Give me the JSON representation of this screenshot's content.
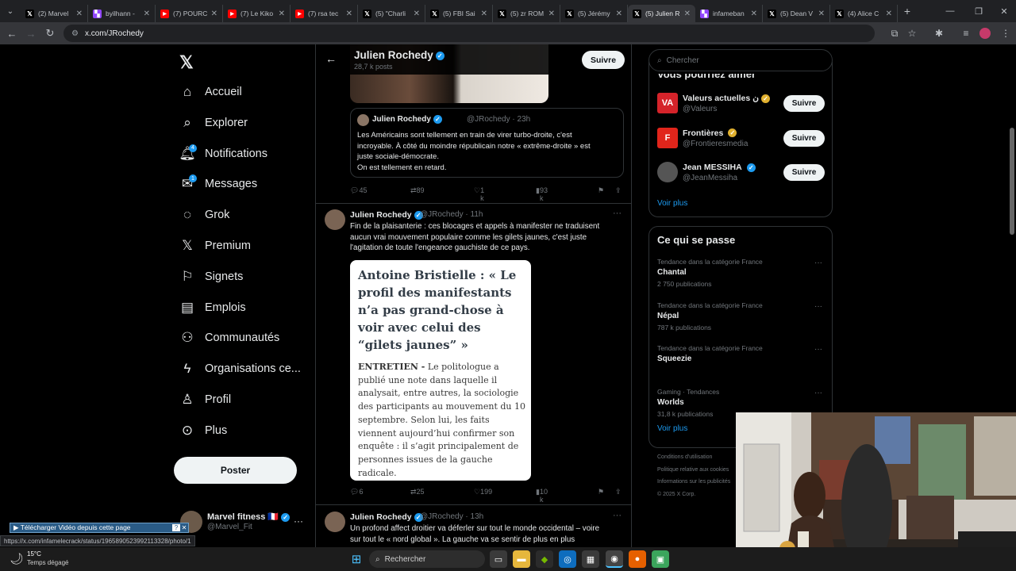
{
  "browser": {
    "tabs": [
      {
        "title": "(2) Marvel",
        "icon": "x-icon",
        "color": "#000000"
      },
      {
        "title": "byilhann -",
        "icon": "twitch-icon",
        "color": "#9146ff"
      },
      {
        "title": "(7) POURC",
        "icon": "youtube-icon",
        "color": "#ff0000"
      },
      {
        "title": "(7) Le Kiko",
        "icon": "youtube-icon",
        "color": "#ff0000"
      },
      {
        "title": "(7) rsa tec",
        "icon": "youtube-icon",
        "color": "#ff0000"
      },
      {
        "title": "(5) \"Charli",
        "icon": "x-icon",
        "color": "#000000"
      },
      {
        "title": "(5) FBI Sai",
        "icon": "x-icon",
        "color": "#000000"
      },
      {
        "title": "(5) zr ROM",
        "icon": "x-icon",
        "color": "#000000"
      },
      {
        "title": "(5) Jérémy",
        "icon": "x-icon",
        "color": "#000000"
      },
      {
        "title": "(5) Julien R",
        "icon": "x-icon",
        "color": "#000000",
        "active": true
      },
      {
        "title": "infameban",
        "icon": "twitch-icon",
        "color": "#9146ff"
      },
      {
        "title": "(5) Dean V",
        "icon": "x-icon",
        "color": "#000000"
      },
      {
        "title": "(4) Alice C",
        "icon": "x-icon",
        "color": "#000000"
      }
    ],
    "url": "x.com/JRochedy",
    "status_url": "https://x.com/infamelecrack/status/1965890523992113328/photo/1",
    "download_bar": "▶ Télécharger Vidéo depuis cette page"
  },
  "sidebar": {
    "logo": "X",
    "items": [
      {
        "label": "Accueil",
        "icon": "home-icon"
      },
      {
        "label": "Explorer",
        "icon": "search-icon"
      },
      {
        "label": "Notifications",
        "icon": "bell-icon",
        "badge": "4"
      },
      {
        "label": "Messages",
        "icon": "mail-icon",
        "badge": "1"
      },
      {
        "label": "Grok",
        "icon": "grok-icon"
      },
      {
        "label": "Premium",
        "icon": "x-icon"
      },
      {
        "label": "Signets",
        "icon": "bookmark-icon"
      },
      {
        "label": "Emplois",
        "icon": "briefcase-icon"
      },
      {
        "label": "Communautés",
        "icon": "people-icon"
      },
      {
        "label": "Organisations ce...",
        "icon": "bolt-icon"
      },
      {
        "label": "Profil",
        "icon": "person-icon"
      },
      {
        "label": "Plus",
        "icon": "more-circle-icon"
      }
    ],
    "post_button": "Poster",
    "account": {
      "name": "Marvel fitness 🇫🇷",
      "handle": "@Marvel_Fit",
      "more": "···"
    }
  },
  "timeline": {
    "header": {
      "title": "Julien Rochedy",
      "subtitle": "28,7 k posts",
      "follow": "Suivre"
    },
    "post1": {
      "quote": {
        "name": "Julien Rochedy",
        "handle": "@JRochedy · 23h",
        "text_l1": "Les Américains sont tellement en train de virer turbo-droite, c'est",
        "text_l2": "incroyable. À côté du moindre républicain notre « extrême-droite » est",
        "text_l3": "juste sociale-démocrate.",
        "text_l4": "On est tellement en retard."
      },
      "replies": "45",
      "reposts": "89",
      "likes": "1 k",
      "views": "93 k"
    },
    "post2": {
      "name": "Julien Rochedy",
      "handle": "@JRochedy · 11h",
      "more": "···",
      "text_l1": "Fin de la plaisanterie : ces blocages et appels à manifester ne traduisent",
      "text_l2": "aucun vrai mouvement populaire comme les gilets jaunes, c'est juste",
      "text_l3": "l'agitation de toute l'engeance gauchiste de ce pays.",
      "article_title": "Antoine Bristielle : « Le profil des manifestants n’a pas grand-chose à voir avec celui des “gilets jaunes” »",
      "article_kicker": "ENTRETIEN -",
      "article_body": " Le politologue a publié une note dans laquelle il analysait, entre autres, la sociologie des participants au mouvement du 10 septembre. Selon lui, les faits viennent aujourd’hui confirmer son enquête : il s’agit principalement de personnes issues de la gauche radicale.",
      "replies": "6",
      "reposts": "25",
      "likes": "199",
      "views": "10 k"
    },
    "post3": {
      "name": "Julien Rochedy",
      "handle": "@JRochedy · 13h",
      "more": "···",
      "text_l1": "Un profond affect droitier va déferler sur tout le monde occidental – voire",
      "text_l2": "sur tout le « nord global ». La gauche va se sentir de plus en plus"
    }
  },
  "right": {
    "search_placeholder": "Chercher",
    "suggestions_title": "Vous pourriez aimer",
    "suggestions": [
      {
        "name": "Valeurs actuelles",
        "extra": "ن",
        "handle": "@Valeurs",
        "badge": "gold",
        "avatar": "VA",
        "color": "#d5232a",
        "follow": "Suivre"
      },
      {
        "name": "Frontières",
        "extra": "",
        "handle": "@Frontieresmedia",
        "badge": "gold",
        "avatar": "F",
        "color": "#e1251b",
        "follow": "Suivre"
      },
      {
        "name": "Jean MESSIHA",
        "extra": "",
        "handle": "@JeanMessiha",
        "badge": "blue",
        "avatar": "",
        "color": "#555555",
        "follow": "Suivre"
      }
    ],
    "suggestions_more": "Voir plus",
    "trends_title": "Ce qui se passe",
    "trends": [
      {
        "category": "Tendance dans la catégorie France",
        "name": "Chantal",
        "count": "2 750 publications"
      },
      {
        "category": "Tendance dans la catégorie France",
        "name": "Népal",
        "count": "787 k publications"
      },
      {
        "category": "Tendance dans la catégorie France",
        "name": "Squeezie",
        "count": ""
      },
      {
        "category": "Gaming · Tendances",
        "name": "Worlds",
        "count": "31,8 k publications"
      }
    ],
    "trends_more": "Voir plus",
    "footer": [
      "Conditions d'utilisation",
      "Politique relative aux cookies",
      "Informations sur les publicités",
      "© 2025 X Corp."
    ]
  },
  "taskbar": {
    "weather_temp": "15°C",
    "weather_desc": "Temps dégagé",
    "search": "Rechercher"
  }
}
